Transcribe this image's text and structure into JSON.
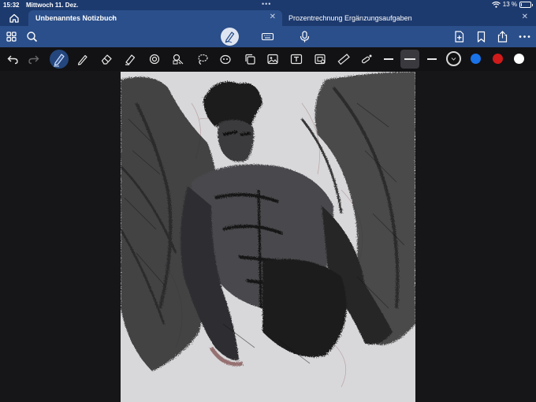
{
  "status_bar": {
    "time": "15:32",
    "date": "Mittwoch 11. Dez.",
    "battery_percent": "13 %",
    "battery_level": 0.13
  },
  "tabs": [
    {
      "label": "Unbenanntes Notizbuch",
      "active": true
    },
    {
      "label": "Prozentrechnung Ergänzungsaufgaben",
      "active": false
    }
  ],
  "toolbar": {
    "left_icons": [
      "grid-icon",
      "search-icon"
    ],
    "center_icons": [
      "pen-mode-icon",
      "keyboard-icon",
      "microphone-icon"
    ],
    "right_icons": [
      "add-page-icon",
      "bookmark-icon",
      "share-icon",
      "more-icon"
    ]
  },
  "pen_tools": {
    "items": [
      "undo-icon",
      "redo-icon",
      "fountain-pen-icon",
      "pencil-icon",
      "eraser-icon",
      "highlighter-icon",
      "shape-icon",
      "lasso-select-icon",
      "lasso-icon",
      "sticker-icon",
      "copy-icon",
      "image-icon",
      "text-box-icon",
      "screenshot-icon",
      "ruler-icon",
      "laser-pointer-icon"
    ],
    "stroke_widths": [
      "thin",
      "medium",
      "thick"
    ],
    "selected_stroke": "medium",
    "colors": [
      "#111111",
      "#1a73e8",
      "#d11a1a",
      "#ffffff"
    ],
    "selected_color": "#111111",
    "accent": "#2b4f8a"
  }
}
